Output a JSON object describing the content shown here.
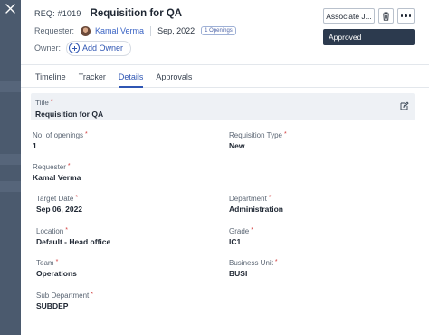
{
  "header": {
    "req_id": "REQ: #1019",
    "title": "Requisition for QA",
    "requester_label": "Requester:",
    "requester_name": "Kamal Verma",
    "date": "Sep, 2022",
    "openings_badge": "1 Openings",
    "owner_label": "Owner:",
    "add_owner": "Add Owner"
  },
  "actions": {
    "associate": "Associate J...",
    "status": "Approved"
  },
  "tabs": [
    "Timeline",
    "Tracker",
    "Details",
    "Approvals"
  ],
  "active_tab": "Details",
  "details": {
    "title": {
      "label": "Title",
      "value": "Requisition for QA"
    },
    "openings": {
      "label": "No. of openings",
      "value": "1"
    },
    "req_type": {
      "label": "Requisition Type",
      "value": "New"
    },
    "requester": {
      "label": "Requester",
      "value": "Kamal Verma"
    },
    "target_date": {
      "label": "Target Date",
      "value": "Sep 06, 2022"
    },
    "department": {
      "label": "Department",
      "value": "Administration"
    },
    "location": {
      "label": "Location",
      "value": "Default - Head office"
    },
    "grade": {
      "label": "Grade",
      "value": "IC1"
    },
    "team": {
      "label": "Team",
      "value": "Operations"
    },
    "business_unit": {
      "label": "Business Unit",
      "value": "BUSI"
    },
    "sub_department": {
      "label": "Sub Department",
      "value": "SUBDEP"
    }
  },
  "required_mark": "*",
  "icons": [
    "close-icon",
    "trash-icon",
    "more-icon",
    "plus-circle-icon",
    "edit-icon",
    "avatar"
  ],
  "colors": {
    "accent": "#2f56b3",
    "status_bg": "#2c3a4e",
    "rail": "#4b5a6e",
    "required": "#d13c3c"
  }
}
